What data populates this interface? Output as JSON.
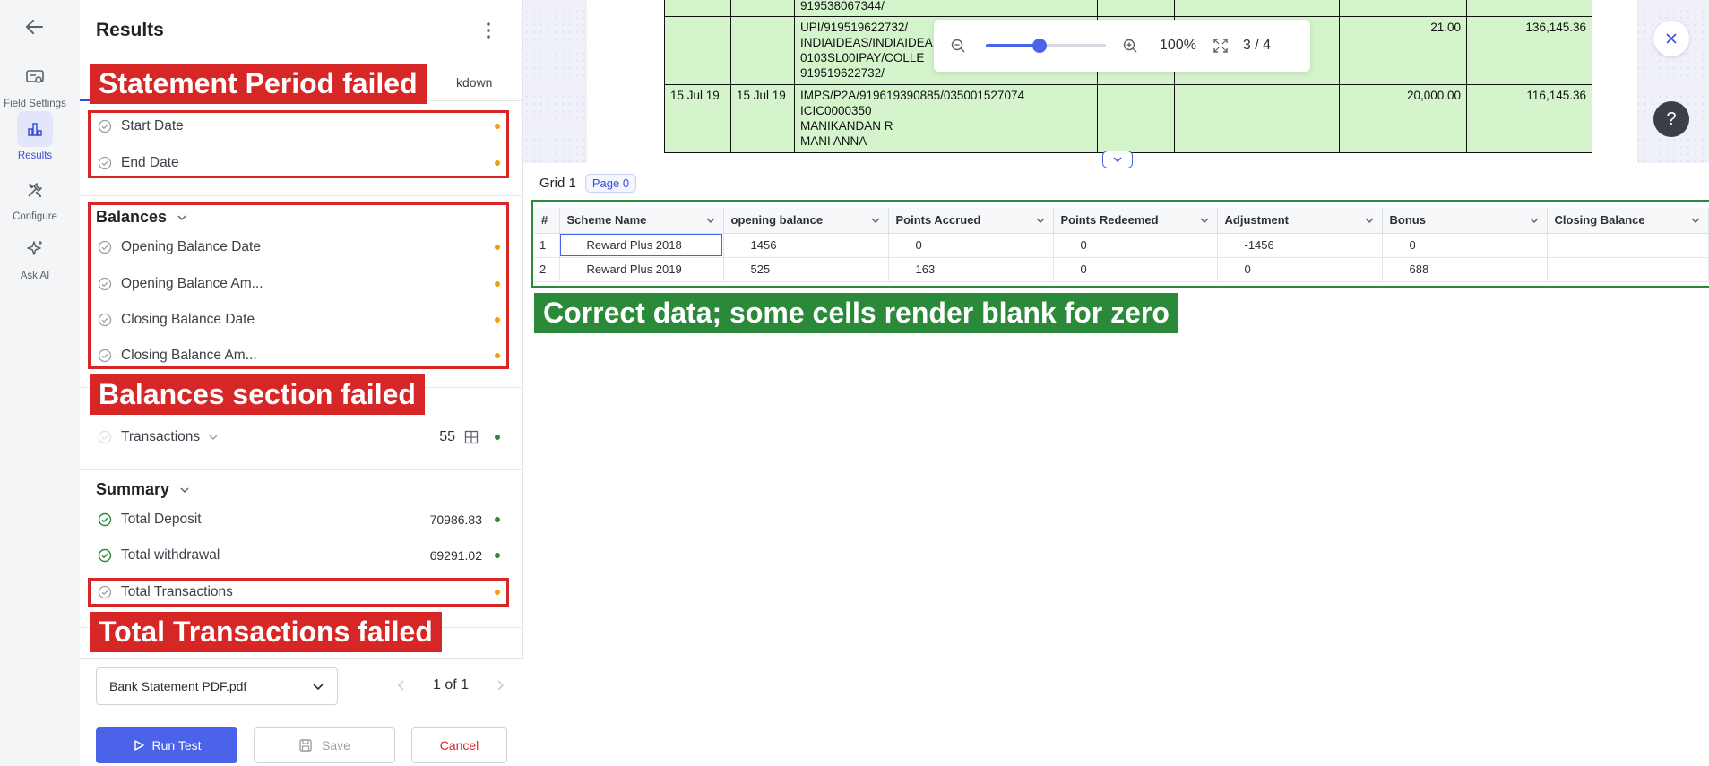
{
  "rail": {
    "items": [
      {
        "label": "Field Settings",
        "icon": "field-settings-icon"
      },
      {
        "label": "Results",
        "icon": "results-icon",
        "active": true
      },
      {
        "label": "Configure",
        "icon": "configure-icon"
      },
      {
        "label": "Ask AI",
        "icon": "sparkle-icon"
      }
    ]
  },
  "panel": {
    "title": "Results",
    "tab_partial": "kdown",
    "statement_period": {
      "rows": [
        {
          "label": "Start Date",
          "status": "pending"
        },
        {
          "label": "End Date",
          "status": "pending"
        }
      ]
    },
    "balances": {
      "title": "Balances",
      "rows": [
        {
          "label": "Opening Balance Date",
          "status": "pending"
        },
        {
          "label": "Opening Balance Am...",
          "status": "pending"
        },
        {
          "label": "Closing Balance Date",
          "status": "pending"
        },
        {
          "label": "Closing Balance Am...",
          "status": "pending"
        }
      ]
    },
    "transactions": {
      "label": "Transactions",
      "count": "55",
      "status": "ok"
    },
    "summary": {
      "title": "Summary",
      "rows": [
        {
          "label": "Total Deposit",
          "value": "70986.83",
          "status": "ok"
        },
        {
          "label": "Total withdrawal",
          "value": "69291.02",
          "status": "ok"
        },
        {
          "label": "Total Transactions",
          "value": "",
          "status": "pending"
        }
      ]
    }
  },
  "annotations": {
    "statement_period": "Statement Period failed",
    "balances": "Balances section failed",
    "total_transactions": "Total Transactions failed",
    "grid": "Correct data; some cells render blank for zero"
  },
  "footer": {
    "file": "Bank Statement PDF.pdf",
    "pager": "1 of 1",
    "run_label": "Run Test",
    "save_label": "Save",
    "cancel_label": "Cancel"
  },
  "viewer": {
    "zoom": "100%",
    "zoom_fraction": 0.45,
    "page": "3 / 4",
    "help": "?",
    "statement_rows": [
      {
        "date1": "",
        "date2": "",
        "desc": [
          "919538067344/"
        ],
        "debit": "",
        "credit": "",
        "balance": ""
      },
      {
        "date1": "",
        "date2": "",
        "desc": [
          "UPI/919519622732/",
          "INDIAIDEAS/INDIAIDEA",
          "0103SL00IPAY/COLLE",
          "919519622732/"
        ],
        "debit": "",
        "credit": "21.00",
        "balance": "136,145.36"
      },
      {
        "date1": "15 Jul 19",
        "date2": "15 Jul 19",
        "desc": [
          "IMPS/P2A/919619390885/035001527074",
          "ICIC0000350",
          "MANIKANDAN R",
          "MANI ANNA"
        ],
        "debit": "",
        "credit": "20,000.00",
        "balance": "116,145.36"
      }
    ]
  },
  "grid": {
    "title": "Grid 1",
    "page_badge": "Page 0",
    "columns": [
      "#",
      "Scheme Name",
      "opening balance",
      "Points Accrued",
      "Points Redeemed",
      "Adjustment",
      "Bonus",
      "Closing Balance"
    ],
    "rows": [
      [
        "1",
        "Reward Plus 2018",
        "1456",
        "0",
        "0",
        "-1456",
        "0",
        ""
      ],
      [
        "2",
        "Reward Plus 2019",
        "525",
        "163",
        "0",
        "0",
        "688",
        ""
      ]
    ]
  },
  "colors": {
    "accent": "#4a63e8",
    "fail": "#d72626",
    "ok": "#2a8a3a",
    "pending_dot": "#f59e0b"
  }
}
